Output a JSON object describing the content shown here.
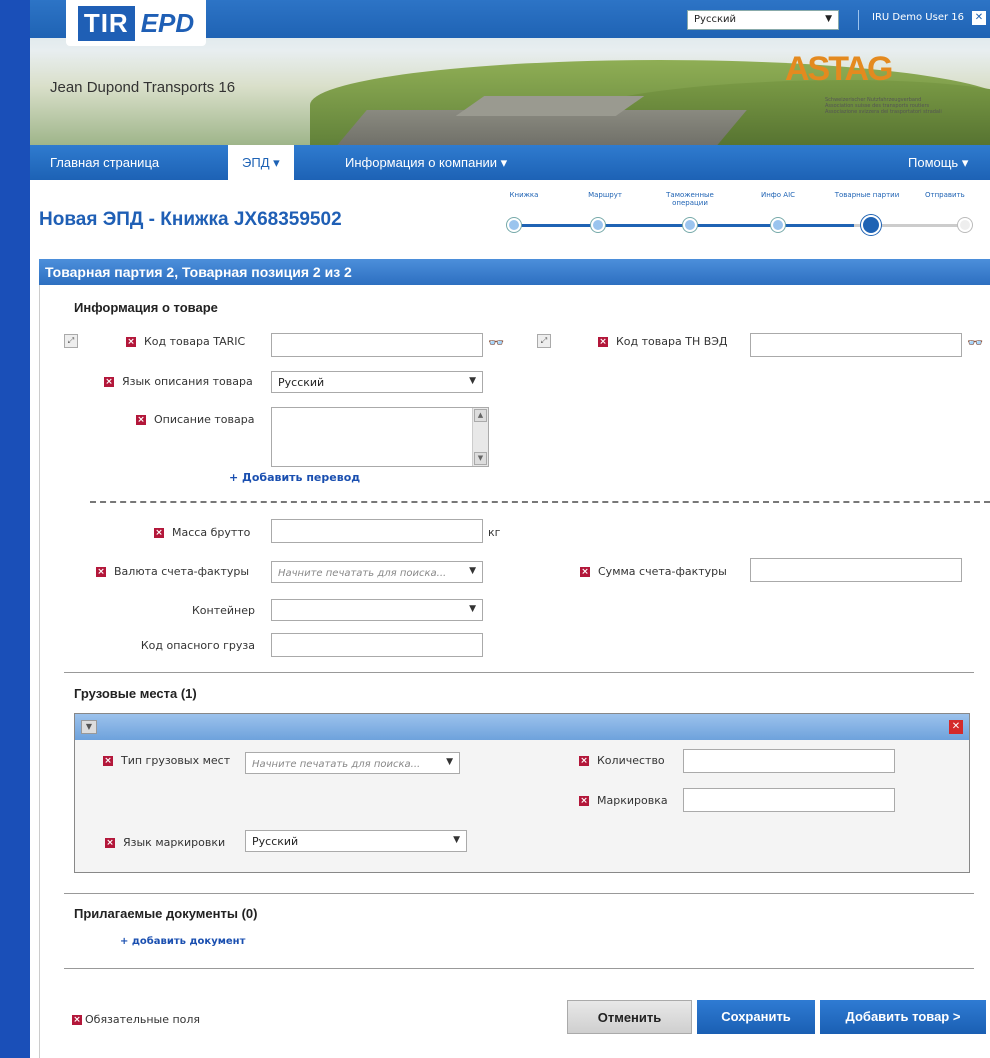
{
  "header": {
    "logo_tir": "TIR",
    "logo_epd": "EPD",
    "company": "Jean Dupond Transports 16",
    "language": "Русский",
    "user": "IRU Demo User 16",
    "astag": "ASTAG",
    "astag_line1": "Schweizerischer Nutzfahrzeugverband",
    "astag_line2": "Association suisse des transports routiers",
    "astag_line3": "Associazione svizzera dei trasportatori stradali"
  },
  "nav": {
    "home": "Главная страница",
    "epd": "ЭПД ▾",
    "company_info": "Информация о компании ▾",
    "help": "Помощь ▾"
  },
  "title": "Новая ЭПД - Книжка JX68359502",
  "steps": [
    {
      "label": "Книжка"
    },
    {
      "label": "Маршрут"
    },
    {
      "label": "Таможенные операции"
    },
    {
      "label": "Инфо AIC"
    },
    {
      "label": "Товарные партии"
    },
    {
      "label": "Отправить"
    }
  ],
  "section_title": "Товарная партия 2, Товарная позиция 2 из 2",
  "goods": {
    "heading": "Информация о товаре",
    "taric_label": "Код товара TARIC",
    "tnved_label": "Код товара ТН ВЭД",
    "desc_lang_label": "Язык описания товара",
    "desc_lang_value": "Русский",
    "desc_label": "Описание товара",
    "add_translation": "+ Добавить перевод",
    "gross_label": "Масса брутто",
    "gross_unit": "кг",
    "currency_label": "Валюта счета-фактуры",
    "search_placeholder": "Начните печатать для поиска...",
    "invoice_sum_label": "Сумма счета-фактуры",
    "container_label": "Контейнер",
    "hazard_label": "Код опасного груза"
  },
  "cargo": {
    "heading": "Грузовые места (1)",
    "type_label": "Тип грузовых мест",
    "type_placeholder": "Начните печатать для поиска...",
    "qty_label": "Количество",
    "marking_label": "Маркировка",
    "marking_lang_label": "Язык маркировки",
    "marking_lang_value": "Русский"
  },
  "docs": {
    "heading": "Прилагаемые документы (0)",
    "add_doc": "+ добавить документ"
  },
  "footer": {
    "required_note": "Обязательные поля",
    "cancel": "Отменить",
    "save": "Сохранить",
    "add_goods": "Добавить товар >"
  }
}
